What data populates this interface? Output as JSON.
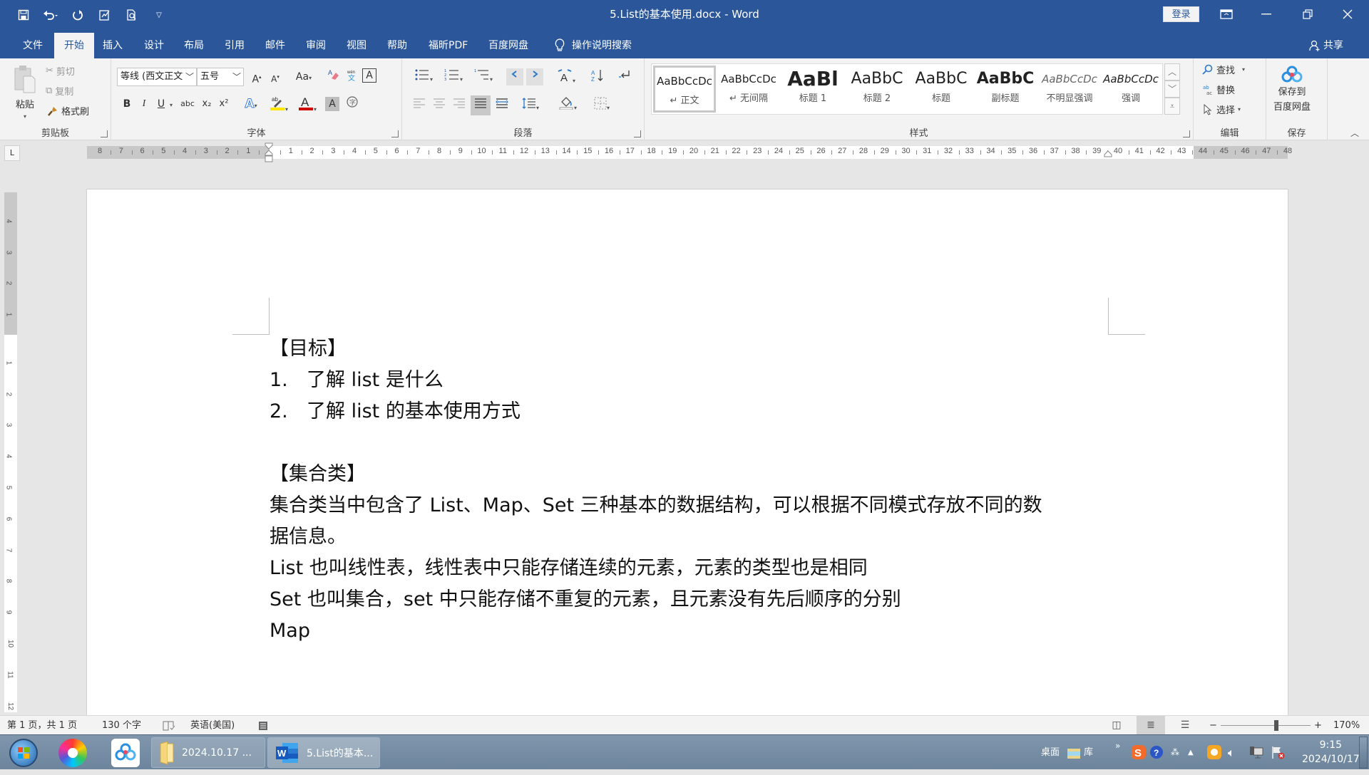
{
  "titlebar": {
    "title": "5.List的基本使用.docx  -  Word",
    "login": "登录",
    "qat_icons": [
      "save-icon",
      "undo-icon",
      "redo-icon",
      "form-icon",
      "print-preview-icon",
      "customize-qat-icon"
    ]
  },
  "tabs": [
    {
      "label": "文件"
    },
    {
      "label": "开始",
      "active": true
    },
    {
      "label": "插入"
    },
    {
      "label": "设计"
    },
    {
      "label": "布局"
    },
    {
      "label": "引用"
    },
    {
      "label": "邮件"
    },
    {
      "label": "审阅"
    },
    {
      "label": "视图"
    },
    {
      "label": "帮助"
    },
    {
      "label": "福昕PDF"
    },
    {
      "label": "百度网盘"
    }
  ],
  "tell_me": "操作说明搜索",
  "share": "共享",
  "ribbon": {
    "clipboard": {
      "label": "剪贴板",
      "paste": "粘贴",
      "cut": "剪切",
      "copy": "复制",
      "format_painter": "格式刷"
    },
    "font": {
      "label": "字体",
      "font_name": "等线 (西文正文",
      "font_size": "五号",
      "bold": "B",
      "italic": "I",
      "underline": "U",
      "strike": "abc",
      "subscript": "x₂",
      "superscript": "x²",
      "change_case": "Aa",
      "grow": "A",
      "shrink": "A",
      "text_effects": "A",
      "char_shading": "A",
      "font_color": "#d00000",
      "highlight_color": "#ffe600"
    },
    "paragraph": {
      "label": "段落"
    },
    "styles": {
      "label": "样式",
      "items": [
        {
          "sample": "AaBbCcDc",
          "name": "↵ 正文",
          "selected": true
        },
        {
          "sample": "AaBbCcDc",
          "name": "↵ 无间隔"
        },
        {
          "sample": "AaBl",
          "name": "标题 1"
        },
        {
          "sample": "AaBbC",
          "name": "标题 2"
        },
        {
          "sample": "AaBbC",
          "name": "标题"
        },
        {
          "sample": "AaBbC",
          "name": "副标题"
        },
        {
          "sample": "AaBbCcDc",
          "name": "不明显强调"
        },
        {
          "sample": "AaBbCcDc",
          "name": "强调"
        }
      ]
    },
    "editing": {
      "label": "编辑",
      "find": "查找",
      "replace": "替换",
      "select": "选择"
    },
    "save": {
      "label": "保存",
      "save_to_baidu_line1": "保存到",
      "save_to_baidu_line2": "百度网盘"
    }
  },
  "ruler": {
    "tab_selector": "L",
    "left_numbers": [
      "8",
      "7",
      "6",
      "5",
      "4",
      "3",
      "2",
      "1"
    ],
    "right_numbers": [
      "1",
      "2",
      "3",
      "4",
      "5",
      "6",
      "7",
      "8",
      "9",
      "10",
      "11",
      "12",
      "13",
      "14",
      "15",
      "16",
      "17",
      "18",
      "19",
      "20",
      "21",
      "22",
      "23",
      "24",
      "25",
      "26",
      "27",
      "28",
      "29",
      "30",
      "31",
      "32",
      "33",
      "34",
      "35",
      "36",
      "37",
      "38",
      "39",
      "40",
      "41",
      "42",
      "43",
      "44",
      "45",
      "46",
      "47",
      "48"
    ],
    "vertical_top": [
      "4",
      "3",
      "2",
      "1"
    ],
    "vertical_body": [
      "1",
      "2",
      "3",
      "4",
      "5",
      "6",
      "7",
      "8",
      "9",
      "10",
      "11",
      "12"
    ]
  },
  "document": {
    "heading1": "【目标】",
    "list": [
      {
        "num": "1.",
        "text": "了解 list 是什么"
      },
      {
        "num": "2.",
        "text": "了解 list 的基本使用方式"
      }
    ],
    "heading2": "【集合类】",
    "para1_line1": "集合类当中包含了 List、Map、Set 三种基本的数据结构，可以根据不同模式存放不同的数",
    "para1_line2": "据信息。",
    "para2": "List 也叫线性表，线性表中只能存储连续的元素，元素的类型也是相同",
    "para3": "Set 也叫集合，set 中只能存储不重复的元素，且元素没有先后顺序的分别",
    "para4": "Map"
  },
  "statusbar": {
    "page": "第 1 页，共 1 页",
    "words": "130 个字",
    "language": "英语(美国)",
    "zoom_label": "170%",
    "zoom_minus": "−",
    "zoom_plus": "+",
    "zoom_fraction": 0.62
  },
  "taskbar": {
    "tasks": [
      {
        "label": "2024.10.17 ..."
      },
      {
        "label": "5.List的基本..."
      }
    ],
    "desktop": "桌面",
    "library": "库",
    "time": "9:15",
    "date": "2024/10/17"
  }
}
